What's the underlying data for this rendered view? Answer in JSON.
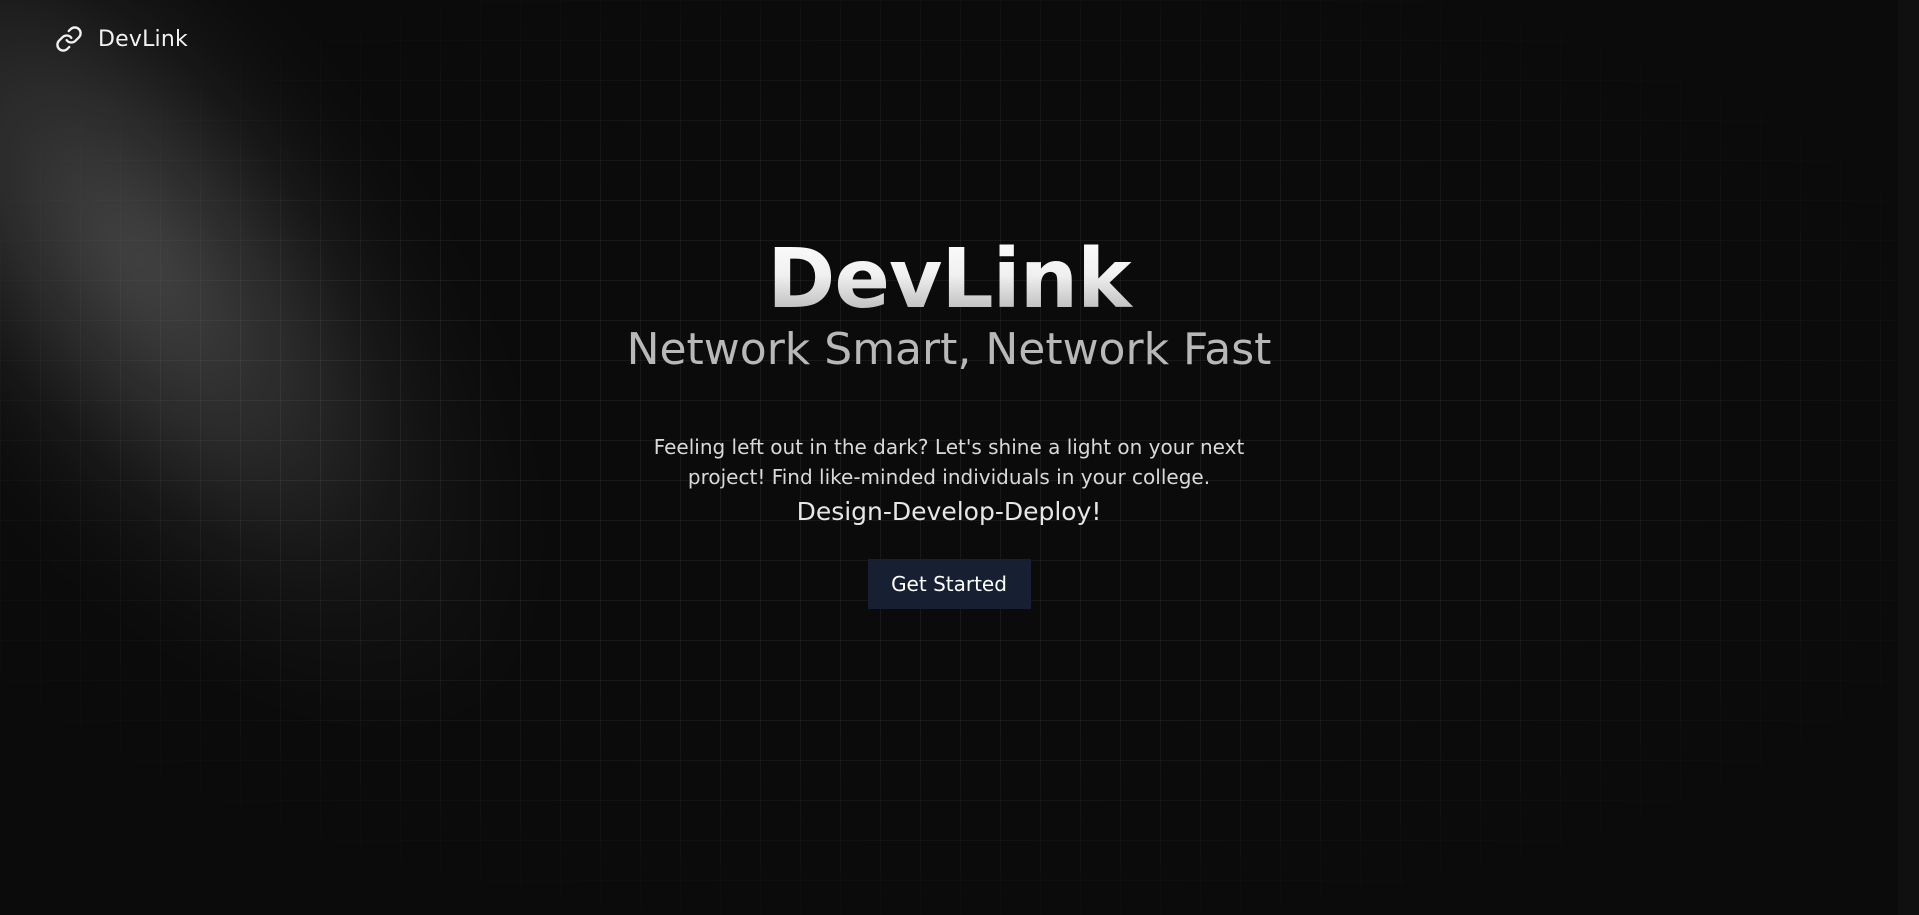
{
  "navbar": {
    "brand": "DevLink",
    "icon": "link-icon"
  },
  "hero": {
    "title": "DevLink",
    "subtitle": "Network Smart, Network Fast",
    "description": "Feeling left out in the dark? Let's shine a light on your next project! Find like-minded individuals in your college.",
    "tagline": "Design-Develop-Deploy!",
    "cta_label": "Get Started"
  },
  "colors": {
    "background": "#0b0b0b",
    "button": "#172033",
    "text": "#f2f2f2",
    "subtitle": "#b8b8b8"
  }
}
